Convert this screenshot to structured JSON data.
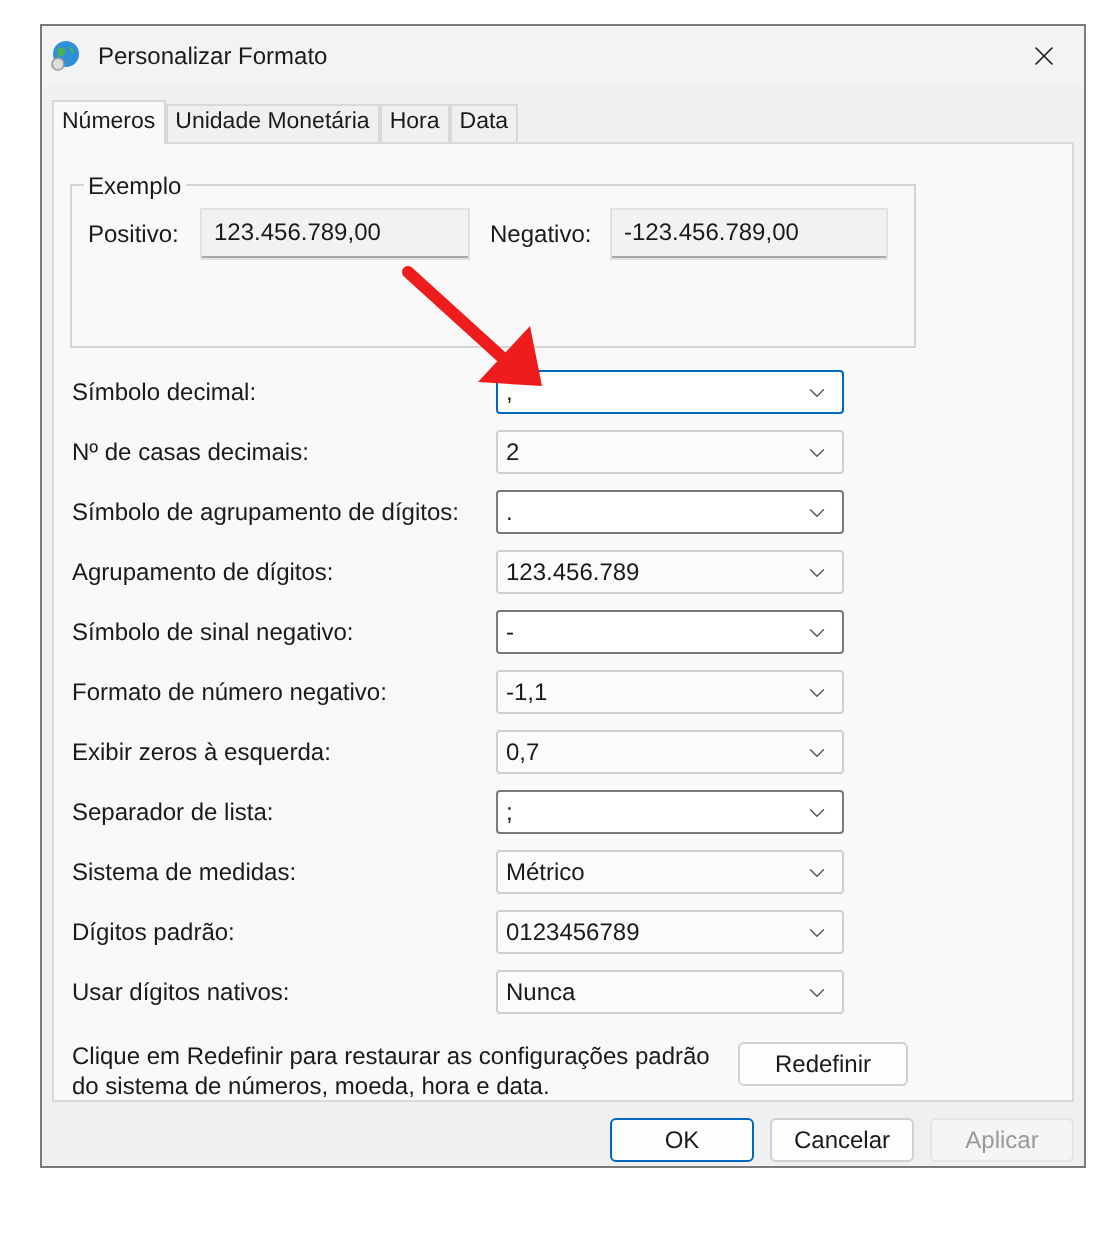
{
  "window": {
    "title": "Personalizar Formato"
  },
  "tabs": [
    {
      "label": "Números",
      "selected": true
    },
    {
      "label": "Unidade Monetária",
      "selected": false
    },
    {
      "label": "Hora",
      "selected": false
    },
    {
      "label": "Data",
      "selected": false
    }
  ],
  "example": {
    "title": "Exemplo",
    "positive_label": "Positivo:",
    "positive_value": "123.456.789,00",
    "negative_label": "Negativo:",
    "negative_value": "-123.456.789,00"
  },
  "settings": [
    {
      "label": "Símbolo decimal:",
      "value": ",",
      "kind": "editable",
      "focused": true
    },
    {
      "label": "Nº de casas decimais:",
      "value": "2",
      "kind": "list",
      "focused": false
    },
    {
      "label": "Símbolo de agrupamento de dígitos:",
      "value": ".",
      "kind": "editable",
      "focused": false
    },
    {
      "label": "Agrupamento de dígitos:",
      "value": "123.456.789",
      "kind": "list",
      "focused": false
    },
    {
      "label": "Símbolo de sinal negativo:",
      "value": "-",
      "kind": "editable",
      "focused": false
    },
    {
      "label": "Formato de número negativo:",
      "value": "-1,1",
      "kind": "list",
      "focused": false
    },
    {
      "label": "Exibir zeros à esquerda:",
      "value": "0,7",
      "kind": "list",
      "focused": false
    },
    {
      "label": "Separador de lista:",
      "value": ";",
      "kind": "editable",
      "focused": false
    },
    {
      "label": "Sistema de medidas:",
      "value": "Métrico",
      "kind": "list",
      "focused": false
    },
    {
      "label": "Dígitos padrão:",
      "value": "0123456789",
      "kind": "list",
      "focused": false
    },
    {
      "label": "Usar dígitos nativos:",
      "value": "Nunca",
      "kind": "list",
      "focused": false
    }
  ],
  "reset": {
    "text": "Clique em Redefinir para restaurar as configurações padrão do sistema de números, moeda, hora e data.",
    "button": "Redefinir"
  },
  "buttons": [
    {
      "label": "OK",
      "default": true,
      "disabled": false
    },
    {
      "label": "Cancelar",
      "default": false,
      "disabled": false
    },
    {
      "label": "Aplicar",
      "default": false,
      "disabled": true
    }
  ]
}
